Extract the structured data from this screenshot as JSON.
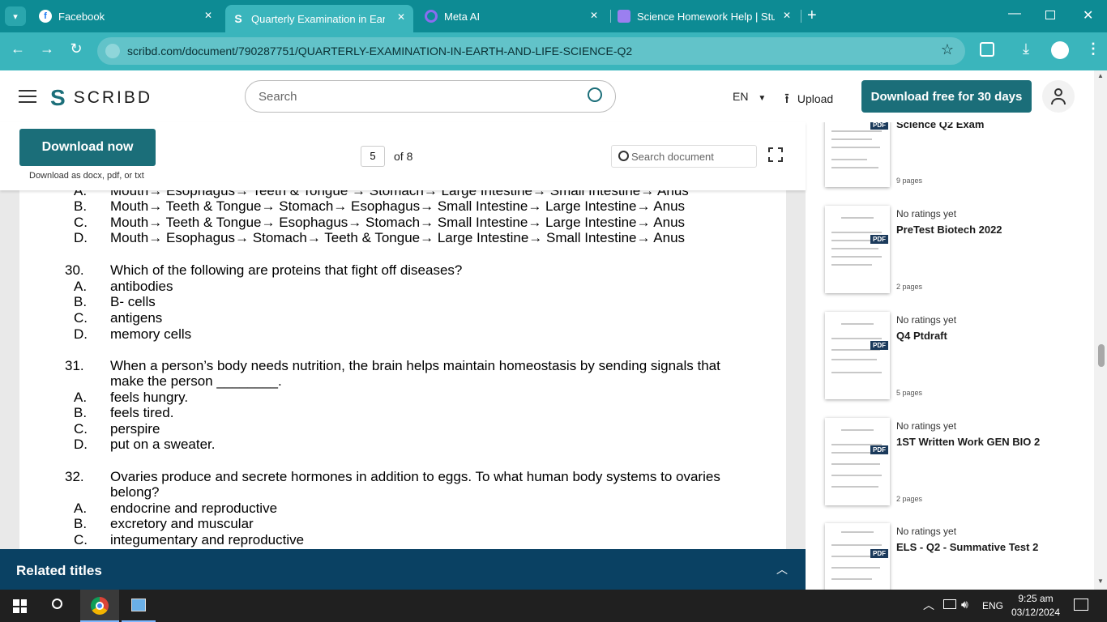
{
  "browser": {
    "tabs": [
      {
        "title": "Facebook"
      },
      {
        "title": "Quarterly Examination in Earth"
      },
      {
        "title": "Meta AI"
      },
      {
        "title": "Science Homework Help | Stud"
      }
    ],
    "url": "scribd.com/document/790287751/QUARTERLY-EXAMINATION-IN-EARTH-AND-LIFE-SCIENCE-Q2"
  },
  "header": {
    "logo": "SCRIBD",
    "search_placeholder": "Search",
    "language": "EN",
    "upload": "Upload",
    "download_free": "Download free for 30 days"
  },
  "doc_toolbar": {
    "download_now": "Download now",
    "download_sub": "Download as docx, pdf, or txt",
    "page_current": "5",
    "page_total": "of 8",
    "search_placeholder": "Search document"
  },
  "document": {
    "partial_top": {
      "letter": "A.",
      "text": "Mouth→ Esophagus→ Teeth & Tongue → Stomach→ Large Intestine→ Small Intestine→ Anus"
    },
    "q29_options": [
      {
        "letter": "B.",
        "text": "Mouth→ Teeth & Tongue→ Stomach→ Esophagus→ Small Intestine→ Large Intestine→ Anus"
      },
      {
        "letter": "C.",
        "text": "Mouth→ Teeth & Tongue→ Esophagus→ Stomach→ Small Intestine→ Large Intestine→ Anus"
      },
      {
        "letter": "D.",
        "text": "Mouth→ Esophagus→ Stomach→ Teeth & Tongue→ Large Intestine→ Small Intestine→ Anus"
      }
    ],
    "q30": {
      "num": "30.",
      "text": "Which of the following are proteins that fight off diseases?",
      "options": [
        {
          "letter": "A.",
          "text": "antibodies"
        },
        {
          "letter": "B.",
          "text": "B- cells"
        },
        {
          "letter": "C.",
          "text": "antigens"
        },
        {
          "letter": "D.",
          "text": "memory cells"
        }
      ]
    },
    "q31": {
      "num": "31.",
      "text1": "When a person’s body needs nutrition, the brain helps maintain homeostasis by sending signals that",
      "text2": "make the person ________.",
      "options": [
        {
          "letter": "A.",
          "text": "feels hungry."
        },
        {
          "letter": "B.",
          "text": "feels tired."
        },
        {
          "letter": "C.",
          "text": "perspire"
        },
        {
          "letter": "D.",
          "text": "put on a sweater."
        }
      ]
    },
    "q32": {
      "num": "32.",
      "text1": "Ovaries produce and secrete hormones in addition to eggs. To what human body systems to ovaries",
      "text2": "belong?",
      "options": [
        {
          "letter": "A.",
          "text": "endocrine and reproductive"
        },
        {
          "letter": "B.",
          "text": "excretory and muscular"
        },
        {
          "letter": "C.",
          "text": "integumentary and reproductive"
        }
      ]
    }
  },
  "related": {
    "title": "Related titles"
  },
  "sidebar": {
    "cards": [
      {
        "title": "Science Q2 Exam",
        "pages": "9 pages",
        "rating": ""
      },
      {
        "rating": "No ratings yet",
        "title": "PreTest Biotech 2022",
        "pages": "2 pages"
      },
      {
        "rating": "No ratings yet",
        "title": "Q4 Ptdraft",
        "pages": "5 pages"
      },
      {
        "rating": "No ratings yet",
        "title": "1ST Written Work GEN BIO 2",
        "pages": "2 pages"
      },
      {
        "rating": "No ratings yet",
        "title": "ELS - Q2 - Summative Test 2",
        "pages": ""
      }
    ],
    "pdf_badge": "PDF"
  },
  "taskbar": {
    "language": "ENG",
    "time": "9:25 am",
    "date": "03/12/2024"
  },
  "colors": {
    "browser_tab": "#0d8b94",
    "address_bar": "#3ab5bc",
    "brand": "#1b6e79",
    "related_bar": "#0a4163"
  }
}
